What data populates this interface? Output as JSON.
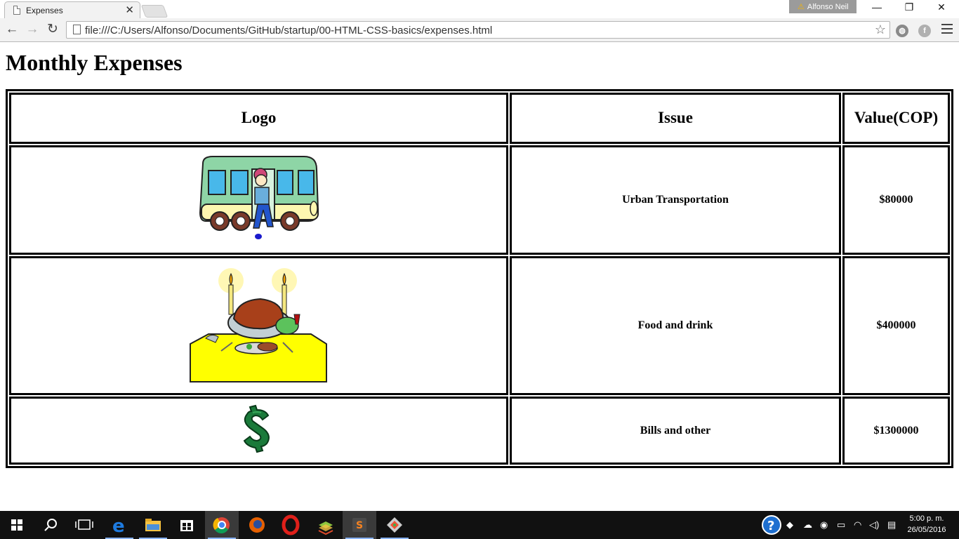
{
  "browser": {
    "tab_title": "Expenses",
    "tab_close": "✕",
    "profile_name": "Alfonso Neil",
    "profile_warning": "⚠",
    "url": "file:///C:/Users/Alfonso/Documents/GitHub/startup/00-HTML-CSS-basics/expenses.html",
    "window_buttons": {
      "minimize": "—",
      "maximize": "❐",
      "close": "✕"
    },
    "nav": {
      "back": "←",
      "forward": "→",
      "reload": "↻"
    },
    "extensions": [
      "globe-extension-icon",
      "facebook-extension-icon"
    ]
  },
  "page": {
    "heading": "Monthly Expenses",
    "table": {
      "headers": [
        "Logo",
        "Issue",
        "Value(COP)"
      ],
      "rows": [
        {
          "logo": "bus-icon",
          "issue": "Urban Transportation",
          "value": "$80000"
        },
        {
          "logo": "dinner-table-icon",
          "issue": "Food and drink",
          "value": "$400000"
        },
        {
          "logo": "dollar-sign-icon",
          "issue": "Bills and other",
          "value": "$1300000"
        }
      ]
    }
  },
  "taskbar": {
    "apps": [
      "windows-start-icon",
      "search-icon",
      "task-view-icon",
      "edge-icon",
      "file-explorer-icon",
      "store-icon",
      "chrome-icon",
      "firefox-icon",
      "opera-icon",
      "bluestacks-icon",
      "sublime-text-icon",
      "git-icon"
    ],
    "time": "5:00 p. m.",
    "date": "26/05/2016"
  }
}
